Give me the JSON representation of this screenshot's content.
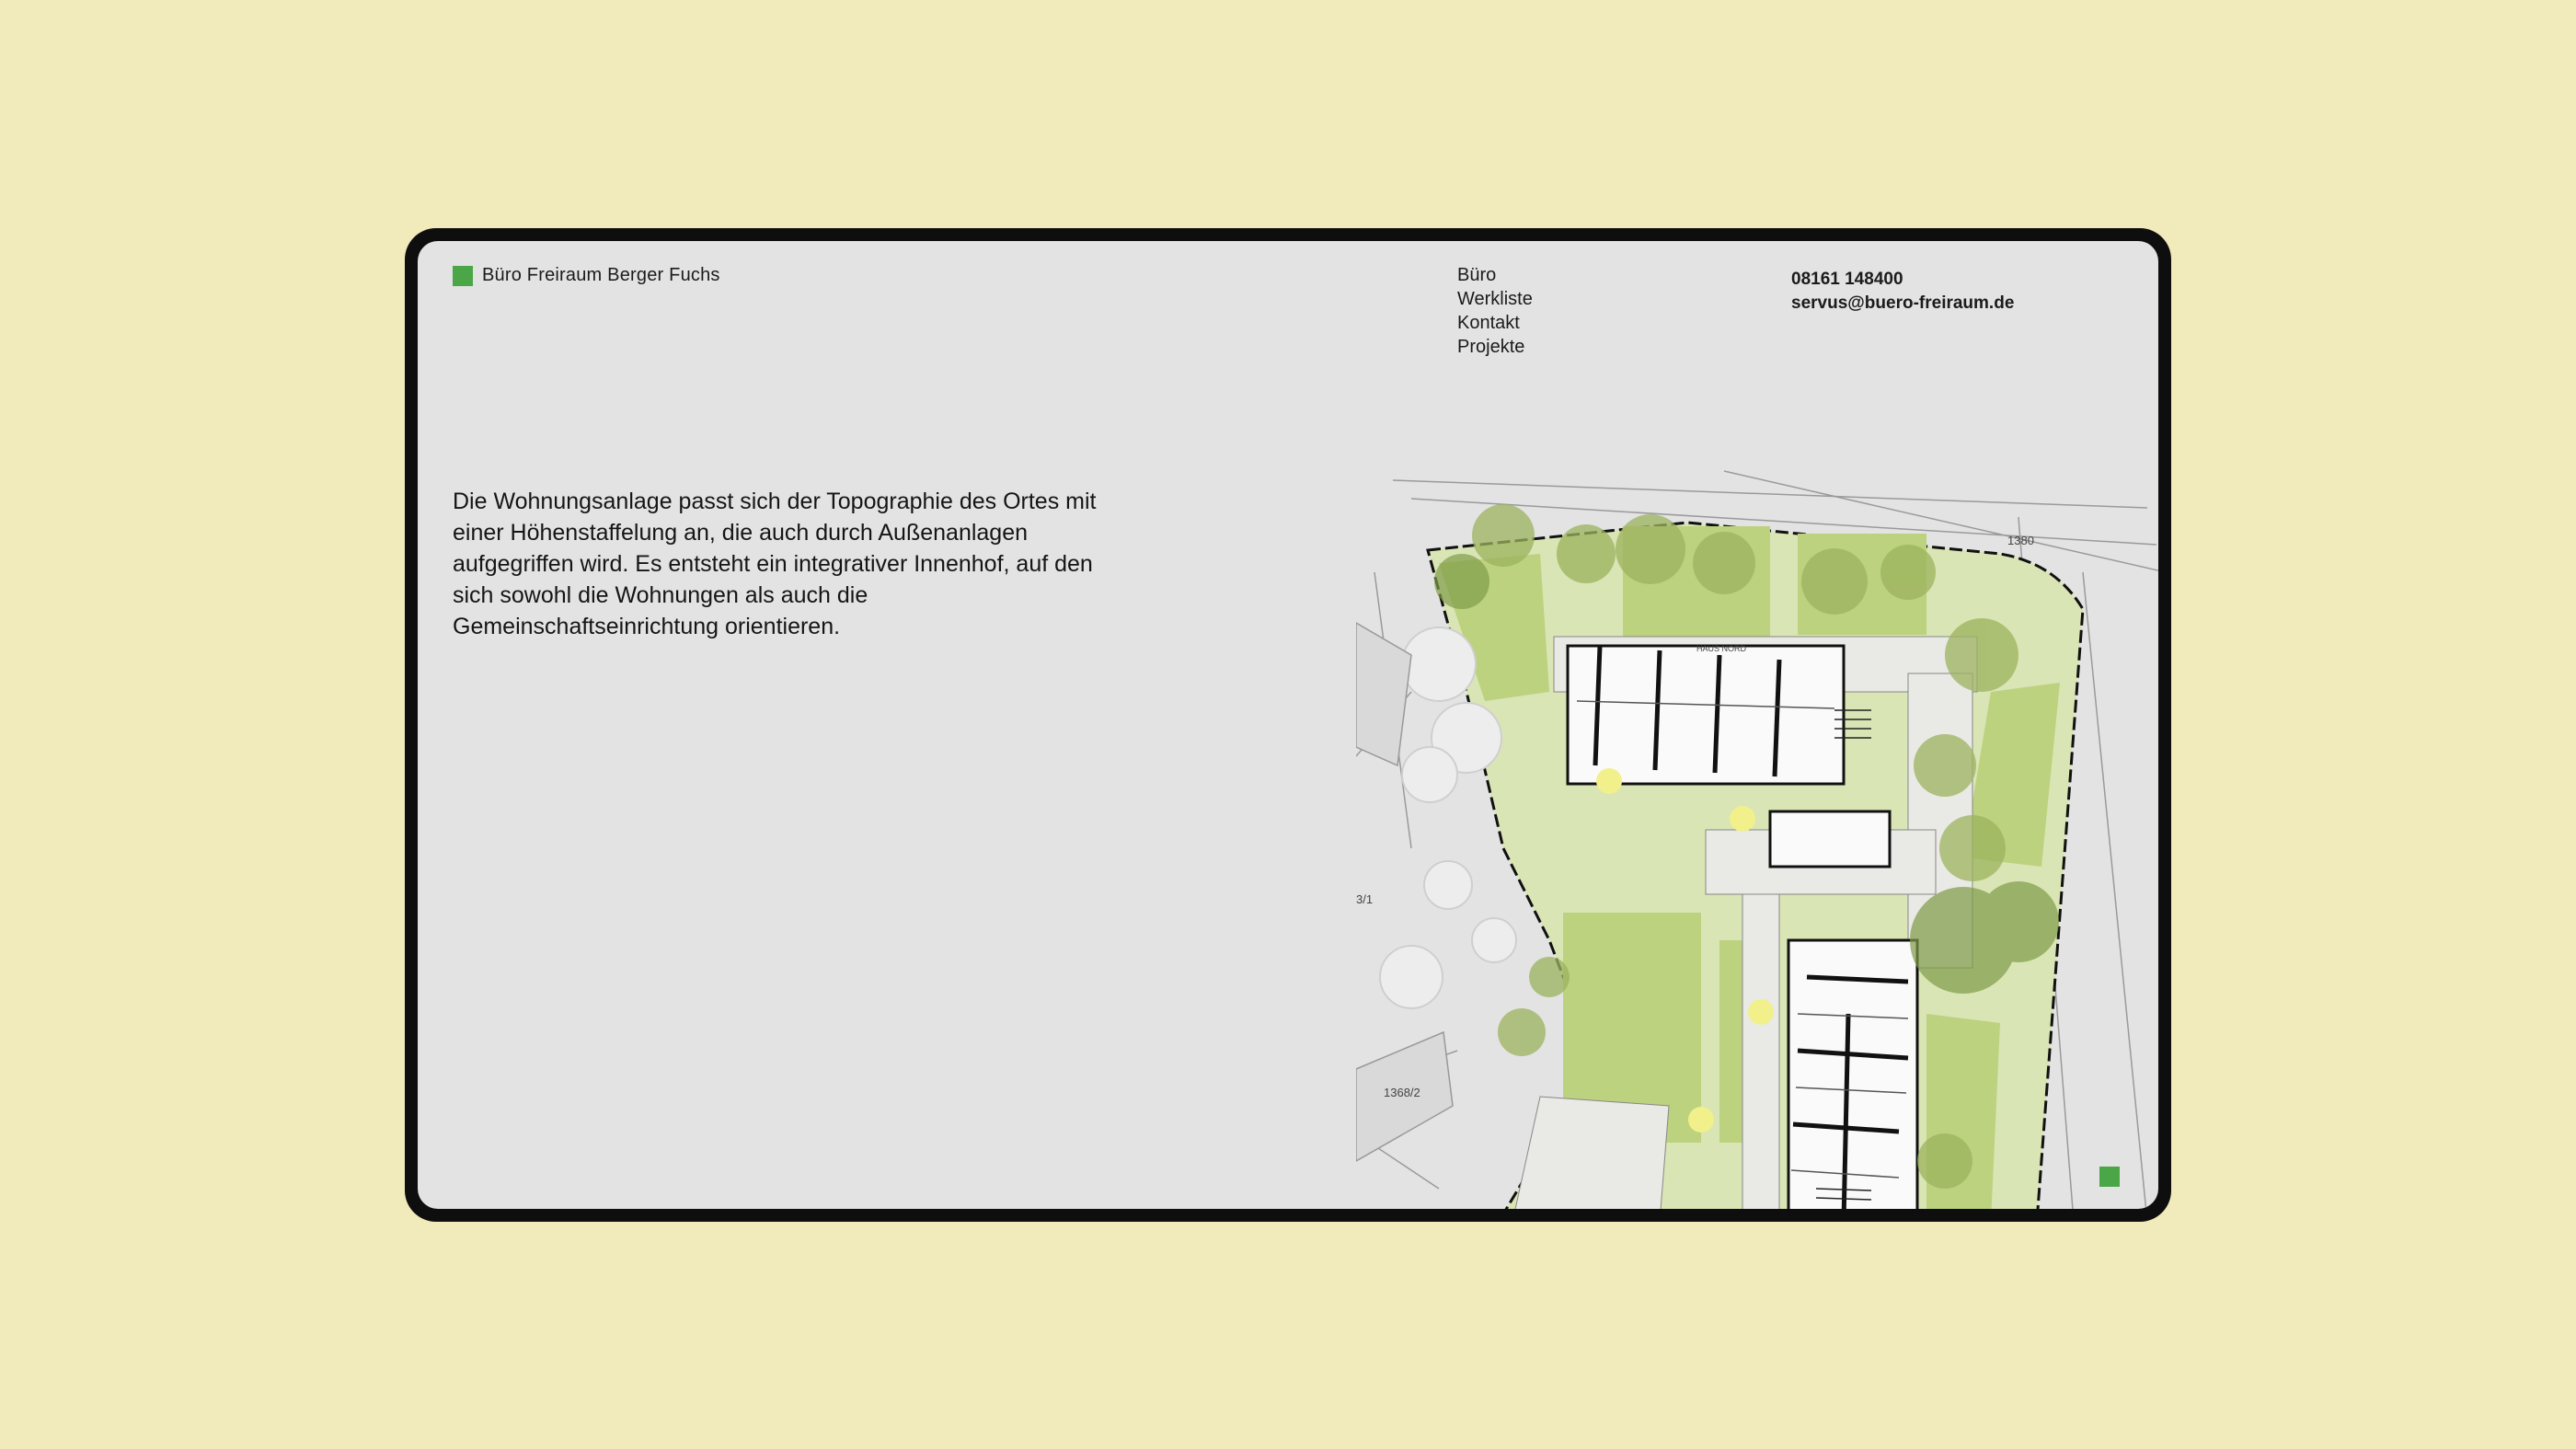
{
  "brand": {
    "name": "Büro Freiraum Berger Fuchs",
    "accent_color": "#4aa646"
  },
  "nav": {
    "items": [
      "Büro",
      "Werkliste",
      "Kontakt",
      "Projekte"
    ]
  },
  "contact": {
    "phone": "08161 148400",
    "email": "servus@buero-freiraum.de"
  },
  "project": {
    "description": "Die Wohnungsanlage passt sich der Topographie des Ortes mit einer Höhenstaffelung an, die auch durch Außenanlagen aufgegriffen wird. Es entsteht ein integrativer Innenhof, auf den sich sowohl die Wohnungen als auch die Gemeinschaftseinrichtung orientieren."
  },
  "site_plan": {
    "labels": {
      "parcel_top_right": "1380",
      "parcel_left_mid": "3/1",
      "parcel_left_bottom": "1368/2",
      "house_label": "HAUS NORD"
    }
  },
  "colors": {
    "page_background": "#f1eabb",
    "screen_background": "#e3e3e3",
    "device_frame": "#0e0e0e"
  }
}
